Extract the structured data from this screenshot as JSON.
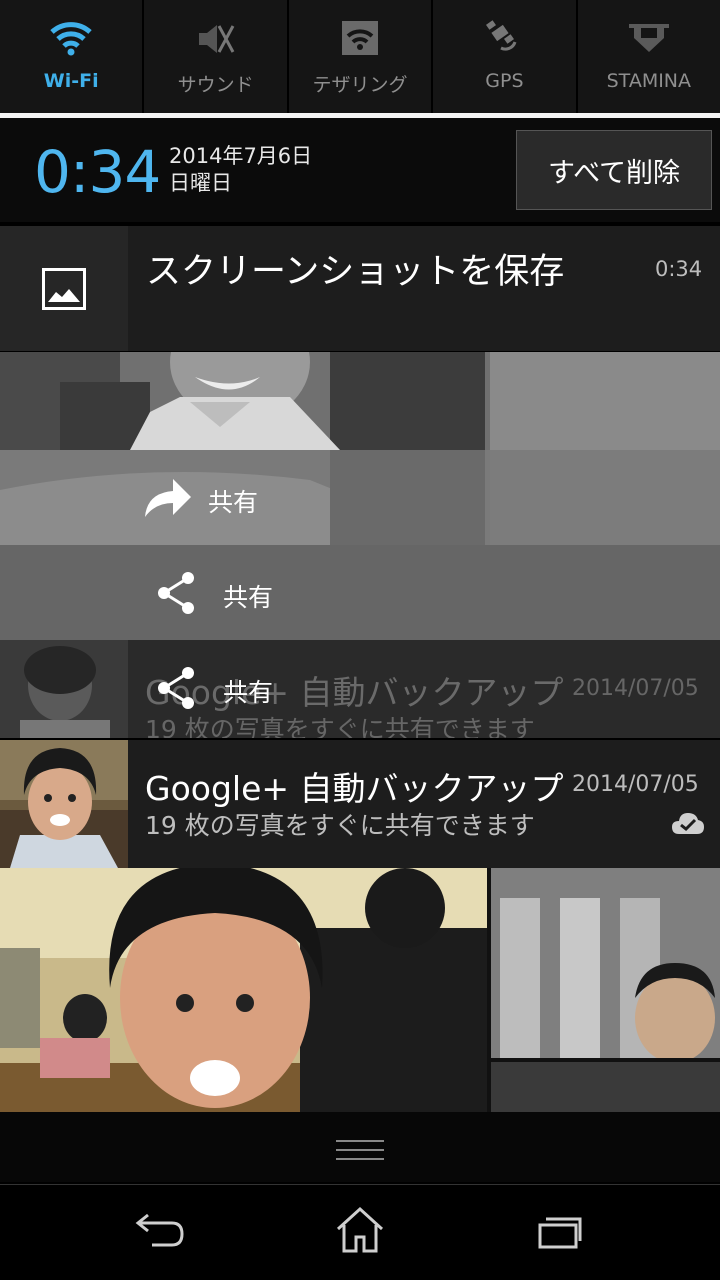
{
  "quick_settings": {
    "tiles": [
      {
        "label": "Wi-Fi",
        "icon": "wifi-icon",
        "active": true
      },
      {
        "label": "サウンド",
        "icon": "sound-off-icon",
        "active": false
      },
      {
        "label": "テザリング",
        "icon": "tethering-icon",
        "active": false
      },
      {
        "label": "GPS",
        "icon": "gps-icon",
        "active": false
      },
      {
        "label": "STAMINA",
        "icon": "stamina-icon",
        "active": false
      }
    ]
  },
  "header": {
    "time": "0:34",
    "date": "2014年7月6日",
    "weekday": "日曜日",
    "clear_all": "すべて削除"
  },
  "screenshot_notification": {
    "title": "スクリーンショットを保存",
    "time": "0:34",
    "icon": "picture-icon",
    "actions": [
      {
        "label": "共有",
        "icon": "forward-share-icon"
      },
      {
        "label": "共有",
        "icon": "share-icon"
      },
      {
        "label": "共有",
        "icon": "share-icon"
      }
    ]
  },
  "gplus_notification": {
    "title": "Google+ 自動バックアップ",
    "date": "2014/07/05",
    "text": "19 枚の写真をすぐに共有できます",
    "icon": "cloud-done-icon"
  },
  "nav": {
    "back": "back-icon",
    "home": "home-icon",
    "recents": "recents-icon"
  },
  "colors": {
    "accent": "#3fb0ea",
    "clock": "#4fb6ef"
  }
}
